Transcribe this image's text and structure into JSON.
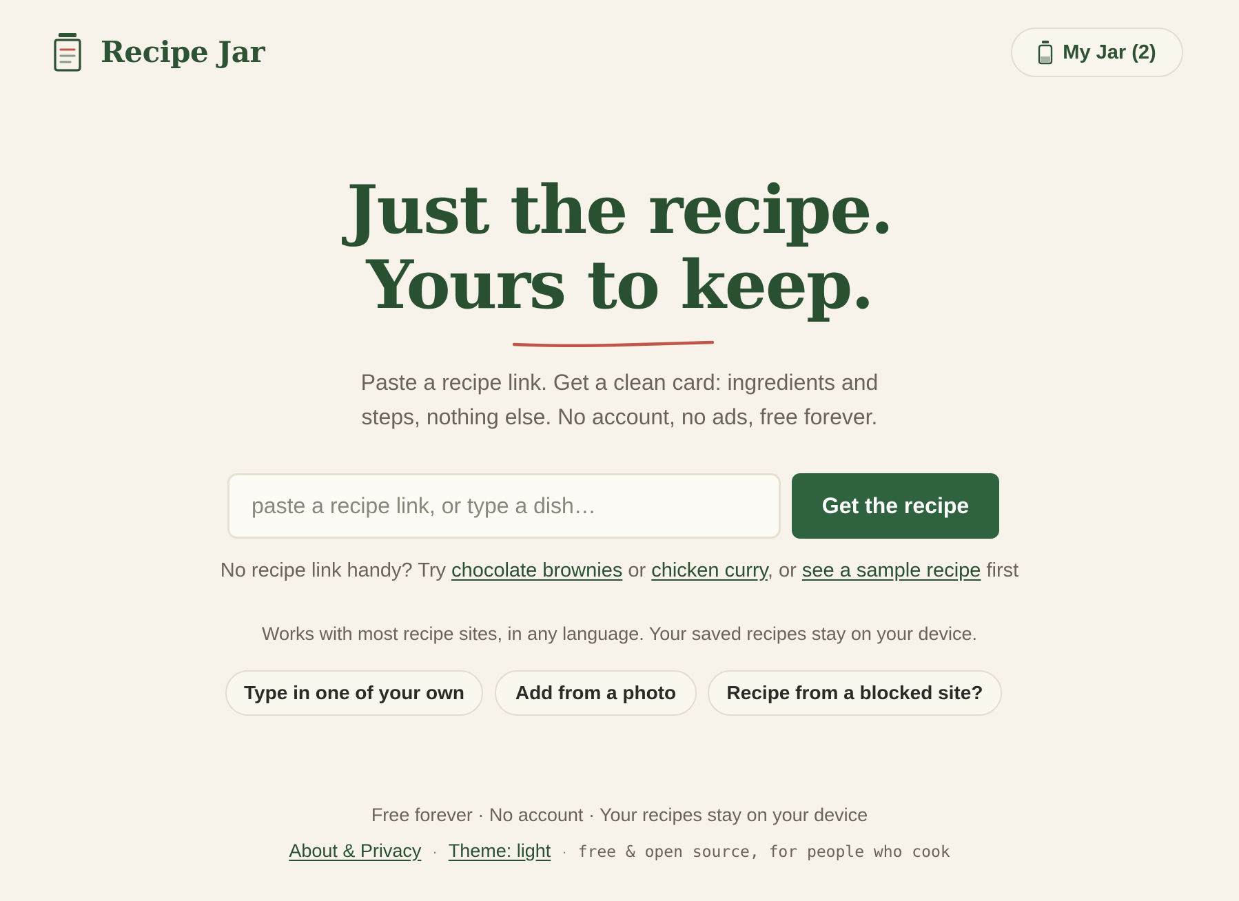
{
  "header": {
    "brand_name": "Recipe Jar",
    "jar_button_label": "My Jar (2)"
  },
  "hero": {
    "title_line1": "Just the recipe.",
    "title_line2": "Yours to keep.",
    "subtitle_line1": "Paste a recipe link. Get a clean card: ingredients and",
    "subtitle_line2": "steps, nothing else. No account, no ads, free forever."
  },
  "search": {
    "placeholder": "paste a recipe link, or type a dish…",
    "value": "",
    "button_label": "Get the recipe"
  },
  "try_line": {
    "prefix": "No recipe link handy? Try ",
    "link1": "chocolate brownies",
    "sep1": " or ",
    "link2": "chicken curry",
    "sep2": ", or ",
    "link3": "see a sample recipe",
    "suffix": " first"
  },
  "works_line": "Works with most recipe sites, in any language. Your saved recipes stay on your device.",
  "pills": [
    {
      "label": "Type in one of your own"
    },
    {
      "label": "Add from a photo"
    },
    {
      "label": "Recipe from a blocked site?"
    }
  ],
  "footer": {
    "tagline": "Free forever · No account · Your recipes stay on your device",
    "about_link": "About & Privacy",
    "dot": "·",
    "theme_link": "Theme: light",
    "mono_text": "free & open source, for people who cook"
  },
  "colors": {
    "background": "#f7f3ea",
    "brand_green": "#2a5032",
    "button_green": "#2f6340",
    "accent_red": "#c0554a"
  },
  "icons": {
    "brand": "jar-icon",
    "jar_button": "jar-icon"
  }
}
